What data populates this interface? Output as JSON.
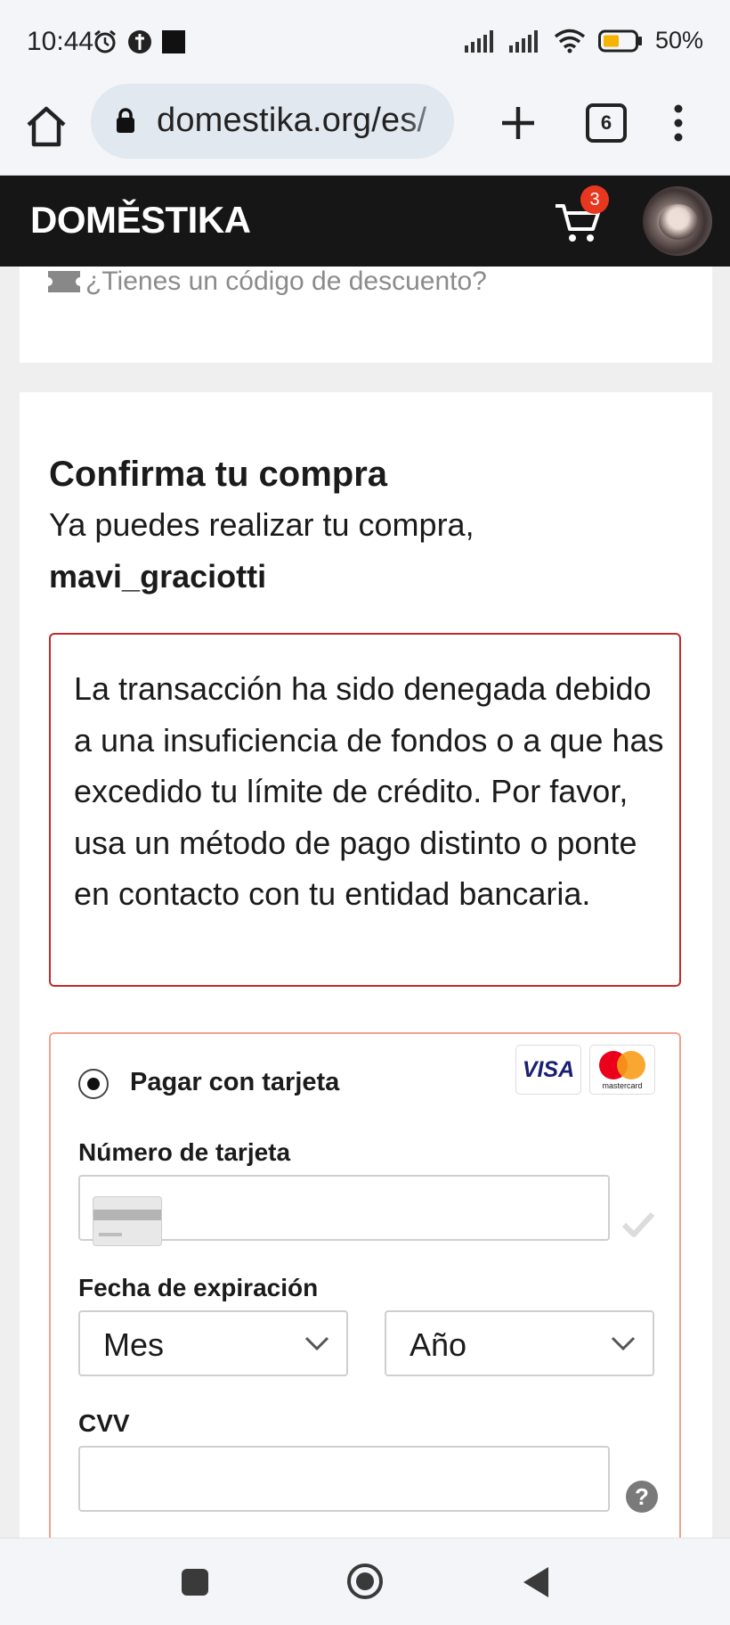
{
  "status_bar": {
    "time": "10:44",
    "battery_percent": "50%",
    "battery_level": 0.5
  },
  "browser": {
    "url": "domestika.org/es/",
    "tab_count": "6"
  },
  "header": {
    "logo": "DOMĚSTIKA",
    "cart_count": "3"
  },
  "discount": {
    "text": "¿Tienes un código de descuento?"
  },
  "confirm": {
    "title": "Confirma tu compra",
    "subtitle": "Ya puedes realizar tu compra,",
    "username": "mavi_graciotti"
  },
  "error": {
    "message": "La transacción ha sido denegada debido a una insuficiencia de fondos o a que has excedido tu límite de crédito. Por favor, usa un método de pago distinto o ponte en contacto con tu entidad bancaria."
  },
  "payment": {
    "method_label": "Pagar con tarjeta",
    "visa": "VISA",
    "mastercard": "mastercard",
    "card_number_label": "Número de tarjeta",
    "card_number_value": "",
    "expiration_label": "Fecha de expiración",
    "month_value": "Mes",
    "year_value": "Año",
    "cvv_label": "CVV",
    "cvv_value": "",
    "help_symbol": "?"
  }
}
